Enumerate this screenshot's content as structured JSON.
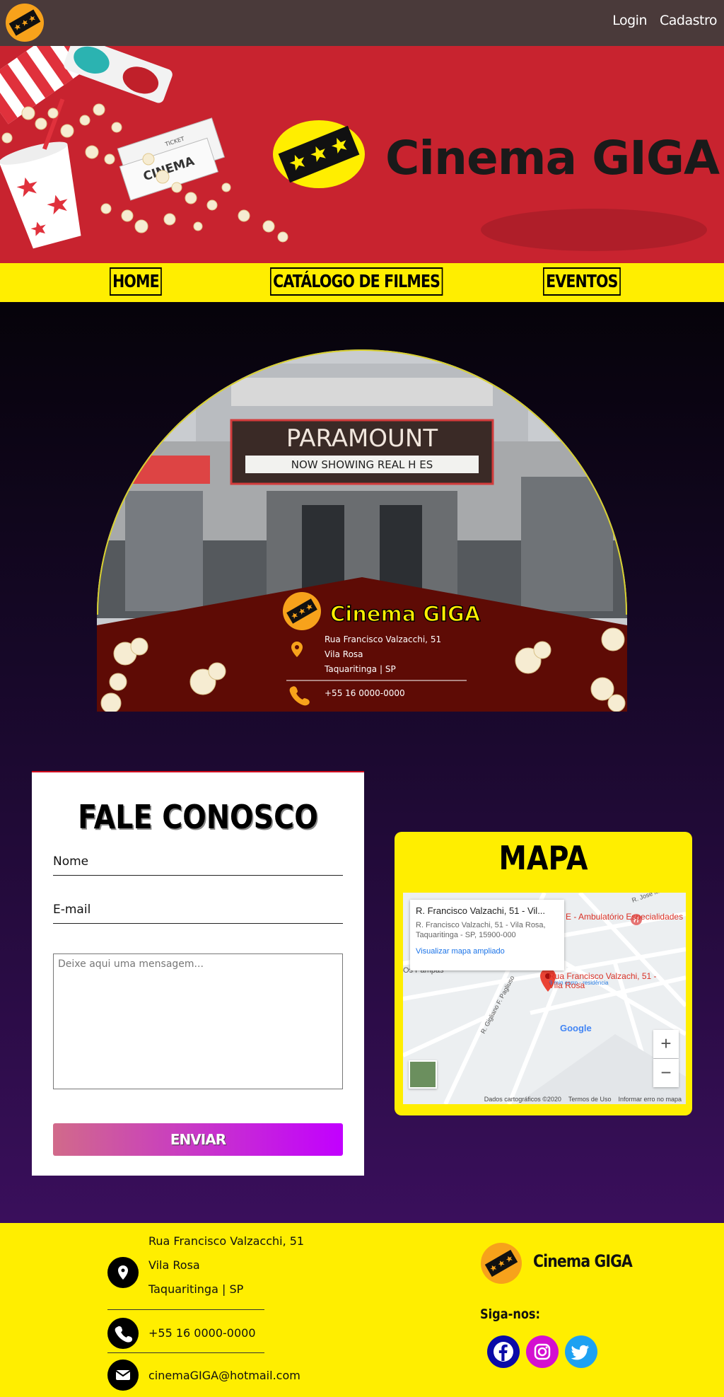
{
  "topbar": {
    "login_label": "Login",
    "signup_label": "Cadastro"
  },
  "banner": {
    "brand_name": "Cinema GIGA",
    "ticket_text": "CINEMA",
    "ticket_label": "TICKET"
  },
  "nav": {
    "items": [
      {
        "label": "HOME"
      },
      {
        "label": "CATÁLOGO DE FILMES"
      },
      {
        "label": "EVENTOS"
      }
    ]
  },
  "theater": {
    "marquee": "PARAMOUNT",
    "now_showing": "NOW SHOWING  REAL  H ES",
    "brand_name": "Cinema GIGA",
    "address_line1": "Rua Francisco Valzacchi, 51",
    "address_line2": "Vila Rosa",
    "address_line3": "Taquaritinga | SP",
    "phone": "+55 16 0000-0000"
  },
  "contact_form": {
    "title": "FALE CONOSCO",
    "name_label": "Nome",
    "email_label": "E-mail",
    "message_placeholder": "Deixe aqui uma mensagem...",
    "submit_label": "ENVIAR"
  },
  "map": {
    "title": "MAPA",
    "popup_title": "R. Francisco Valzachi, 51 - Vil...",
    "popup_address": "R. Francisco Valzachi, 51 - Vila Rosa, Taquaritinga - SP, 15900-000",
    "popup_link": "Visualizar mapa ampliado",
    "pin_label": "Rua Francisco Valzachi, 51 - Vila Rosa",
    "pin_sub": "9 min carro - residência",
    "poi_label": "E - Ambulatório Especialidades",
    "street1": "R. Jose M",
    "street2": "R. Gigliano F. Pagliuso",
    "street3": "Os Pampas",
    "google": "Google",
    "footer_data": "Dados cartográficos ©2020",
    "footer_terms": "Termos de Uso",
    "footer_report": "Informar erro no mapa",
    "zoom_in": "+",
    "zoom_out": "−"
  },
  "footer": {
    "address_line1": "Rua Francisco Valzacchi, 51",
    "address_line2": "Vila Rosa",
    "address_line3": "Taquaritinga | SP",
    "phone": "+55 16 0000-0000",
    "email": "cinemaGIGA@hotmail.com",
    "brand_name": "Cinema GIGA",
    "follow_label": "Siga-nos:"
  },
  "colors": {
    "yellow": "#ffee00",
    "banner_red": "#c8232f",
    "topbar": "#4a3a3a",
    "facebook": "#0a0aa8",
    "instagram": "#d40fd0",
    "twitter": "#1da1f2"
  }
}
